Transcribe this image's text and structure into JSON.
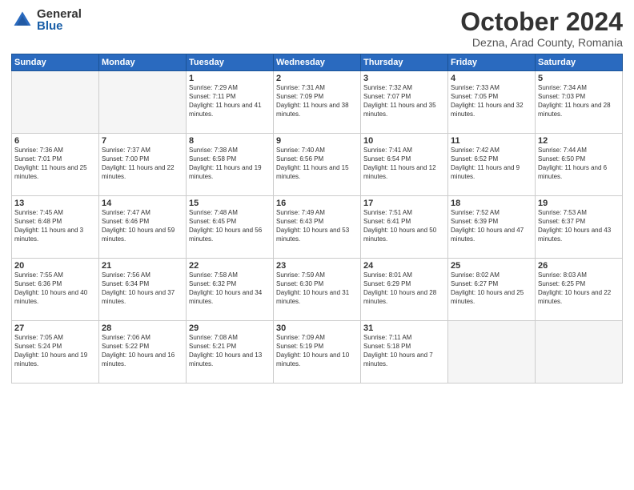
{
  "header": {
    "logo_general": "General",
    "logo_blue": "Blue",
    "month_title": "October 2024",
    "location": "Dezna, Arad County, Romania"
  },
  "days_of_week": [
    "Sunday",
    "Monday",
    "Tuesday",
    "Wednesday",
    "Thursday",
    "Friday",
    "Saturday"
  ],
  "weeks": [
    [
      {
        "day": "",
        "sunrise": "",
        "sunset": "",
        "daylight": "",
        "empty": true
      },
      {
        "day": "",
        "sunrise": "",
        "sunset": "",
        "daylight": "",
        "empty": true
      },
      {
        "day": "1",
        "sunrise": "Sunrise: 7:29 AM",
        "sunset": "Sunset: 7:11 PM",
        "daylight": "Daylight: 11 hours and 41 minutes.",
        "empty": false
      },
      {
        "day": "2",
        "sunrise": "Sunrise: 7:31 AM",
        "sunset": "Sunset: 7:09 PM",
        "daylight": "Daylight: 11 hours and 38 minutes.",
        "empty": false
      },
      {
        "day": "3",
        "sunrise": "Sunrise: 7:32 AM",
        "sunset": "Sunset: 7:07 PM",
        "daylight": "Daylight: 11 hours and 35 minutes.",
        "empty": false
      },
      {
        "day": "4",
        "sunrise": "Sunrise: 7:33 AM",
        "sunset": "Sunset: 7:05 PM",
        "daylight": "Daylight: 11 hours and 32 minutes.",
        "empty": false
      },
      {
        "day": "5",
        "sunrise": "Sunrise: 7:34 AM",
        "sunset": "Sunset: 7:03 PM",
        "daylight": "Daylight: 11 hours and 28 minutes.",
        "empty": false
      }
    ],
    [
      {
        "day": "6",
        "sunrise": "Sunrise: 7:36 AM",
        "sunset": "Sunset: 7:01 PM",
        "daylight": "Daylight: 11 hours and 25 minutes.",
        "empty": false
      },
      {
        "day": "7",
        "sunrise": "Sunrise: 7:37 AM",
        "sunset": "Sunset: 7:00 PM",
        "daylight": "Daylight: 11 hours and 22 minutes.",
        "empty": false
      },
      {
        "day": "8",
        "sunrise": "Sunrise: 7:38 AM",
        "sunset": "Sunset: 6:58 PM",
        "daylight": "Daylight: 11 hours and 19 minutes.",
        "empty": false
      },
      {
        "day": "9",
        "sunrise": "Sunrise: 7:40 AM",
        "sunset": "Sunset: 6:56 PM",
        "daylight": "Daylight: 11 hours and 15 minutes.",
        "empty": false
      },
      {
        "day": "10",
        "sunrise": "Sunrise: 7:41 AM",
        "sunset": "Sunset: 6:54 PM",
        "daylight": "Daylight: 11 hours and 12 minutes.",
        "empty": false
      },
      {
        "day": "11",
        "sunrise": "Sunrise: 7:42 AM",
        "sunset": "Sunset: 6:52 PM",
        "daylight": "Daylight: 11 hours and 9 minutes.",
        "empty": false
      },
      {
        "day": "12",
        "sunrise": "Sunrise: 7:44 AM",
        "sunset": "Sunset: 6:50 PM",
        "daylight": "Daylight: 11 hours and 6 minutes.",
        "empty": false
      }
    ],
    [
      {
        "day": "13",
        "sunrise": "Sunrise: 7:45 AM",
        "sunset": "Sunset: 6:48 PM",
        "daylight": "Daylight: 11 hours and 3 minutes.",
        "empty": false
      },
      {
        "day": "14",
        "sunrise": "Sunrise: 7:47 AM",
        "sunset": "Sunset: 6:46 PM",
        "daylight": "Daylight: 10 hours and 59 minutes.",
        "empty": false
      },
      {
        "day": "15",
        "sunrise": "Sunrise: 7:48 AM",
        "sunset": "Sunset: 6:45 PM",
        "daylight": "Daylight: 10 hours and 56 minutes.",
        "empty": false
      },
      {
        "day": "16",
        "sunrise": "Sunrise: 7:49 AM",
        "sunset": "Sunset: 6:43 PM",
        "daylight": "Daylight: 10 hours and 53 minutes.",
        "empty": false
      },
      {
        "day": "17",
        "sunrise": "Sunrise: 7:51 AM",
        "sunset": "Sunset: 6:41 PM",
        "daylight": "Daylight: 10 hours and 50 minutes.",
        "empty": false
      },
      {
        "day": "18",
        "sunrise": "Sunrise: 7:52 AM",
        "sunset": "Sunset: 6:39 PM",
        "daylight": "Daylight: 10 hours and 47 minutes.",
        "empty": false
      },
      {
        "day": "19",
        "sunrise": "Sunrise: 7:53 AM",
        "sunset": "Sunset: 6:37 PM",
        "daylight": "Daylight: 10 hours and 43 minutes.",
        "empty": false
      }
    ],
    [
      {
        "day": "20",
        "sunrise": "Sunrise: 7:55 AM",
        "sunset": "Sunset: 6:36 PM",
        "daylight": "Daylight: 10 hours and 40 minutes.",
        "empty": false
      },
      {
        "day": "21",
        "sunrise": "Sunrise: 7:56 AM",
        "sunset": "Sunset: 6:34 PM",
        "daylight": "Daylight: 10 hours and 37 minutes.",
        "empty": false
      },
      {
        "day": "22",
        "sunrise": "Sunrise: 7:58 AM",
        "sunset": "Sunset: 6:32 PM",
        "daylight": "Daylight: 10 hours and 34 minutes.",
        "empty": false
      },
      {
        "day": "23",
        "sunrise": "Sunrise: 7:59 AM",
        "sunset": "Sunset: 6:30 PM",
        "daylight": "Daylight: 10 hours and 31 minutes.",
        "empty": false
      },
      {
        "day": "24",
        "sunrise": "Sunrise: 8:01 AM",
        "sunset": "Sunset: 6:29 PM",
        "daylight": "Daylight: 10 hours and 28 minutes.",
        "empty": false
      },
      {
        "day": "25",
        "sunrise": "Sunrise: 8:02 AM",
        "sunset": "Sunset: 6:27 PM",
        "daylight": "Daylight: 10 hours and 25 minutes.",
        "empty": false
      },
      {
        "day": "26",
        "sunrise": "Sunrise: 8:03 AM",
        "sunset": "Sunset: 6:25 PM",
        "daylight": "Daylight: 10 hours and 22 minutes.",
        "empty": false
      }
    ],
    [
      {
        "day": "27",
        "sunrise": "Sunrise: 7:05 AM",
        "sunset": "Sunset: 5:24 PM",
        "daylight": "Daylight: 10 hours and 19 minutes.",
        "empty": false
      },
      {
        "day": "28",
        "sunrise": "Sunrise: 7:06 AM",
        "sunset": "Sunset: 5:22 PM",
        "daylight": "Daylight: 10 hours and 16 minutes.",
        "empty": false
      },
      {
        "day": "29",
        "sunrise": "Sunrise: 7:08 AM",
        "sunset": "Sunset: 5:21 PM",
        "daylight": "Daylight: 10 hours and 13 minutes.",
        "empty": false
      },
      {
        "day": "30",
        "sunrise": "Sunrise: 7:09 AM",
        "sunset": "Sunset: 5:19 PM",
        "daylight": "Daylight: 10 hours and 10 minutes.",
        "empty": false
      },
      {
        "day": "31",
        "sunrise": "Sunrise: 7:11 AM",
        "sunset": "Sunset: 5:18 PM",
        "daylight": "Daylight: 10 hours and 7 minutes.",
        "empty": false
      },
      {
        "day": "",
        "sunrise": "",
        "sunset": "",
        "daylight": "",
        "empty": true
      },
      {
        "day": "",
        "sunrise": "",
        "sunset": "",
        "daylight": "",
        "empty": true
      }
    ]
  ]
}
